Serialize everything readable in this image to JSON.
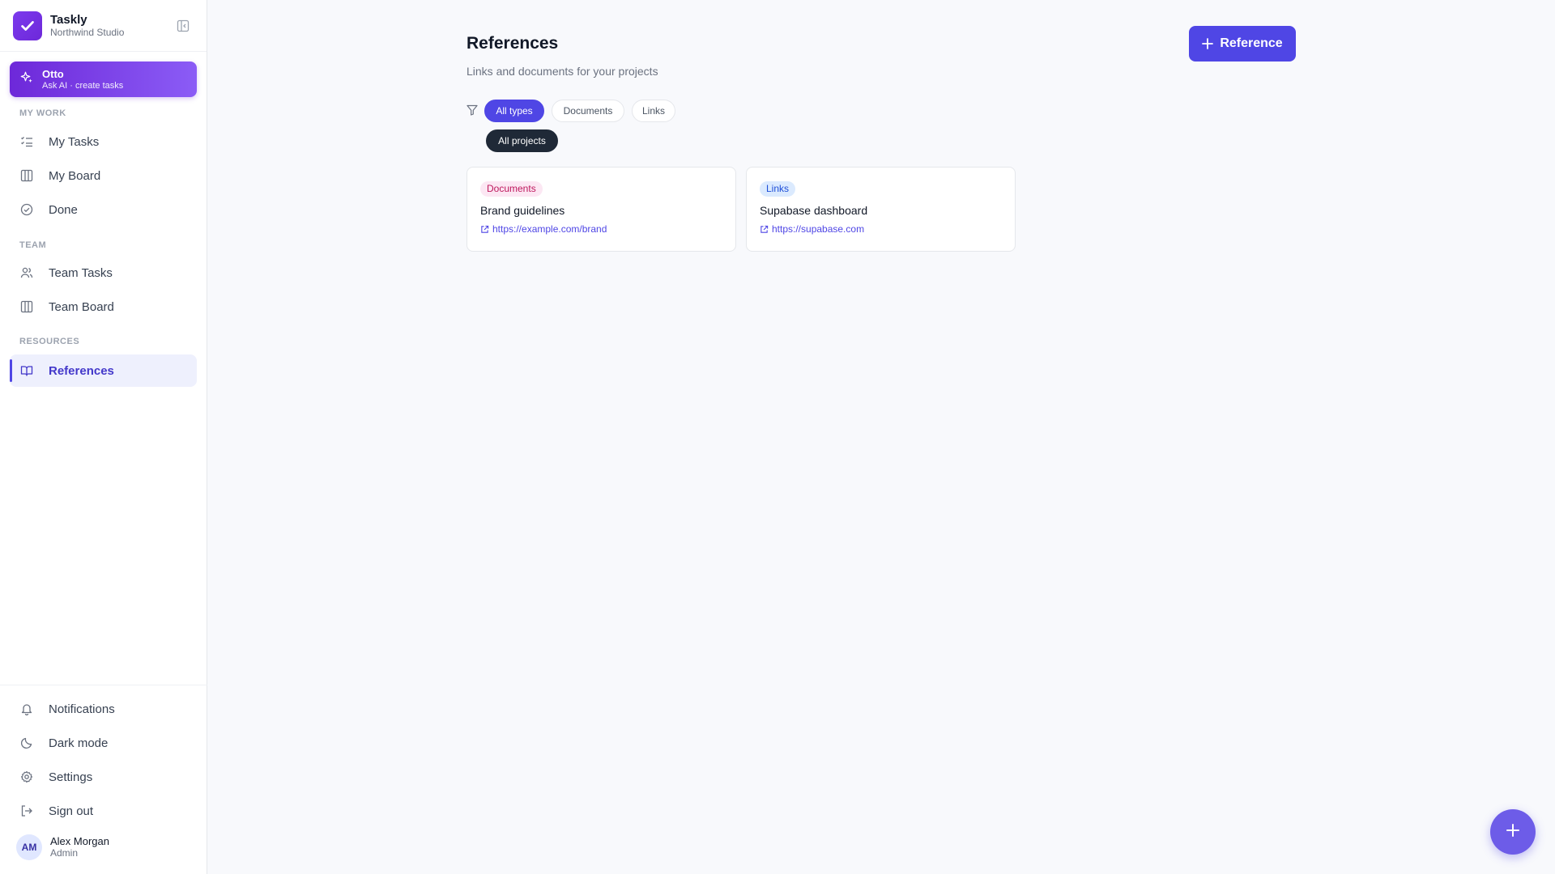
{
  "app": {
    "name": "Taskly",
    "org": "Northwind Studio"
  },
  "otto": {
    "title": "Otto",
    "subtitle": "Ask AI · create tasks"
  },
  "sections": {
    "my_work": "MY WORK",
    "team": "TEAM",
    "resources": "RESOURCES"
  },
  "nav": {
    "my_tasks": "My Tasks",
    "my_board": "My Board",
    "done": "Done",
    "team_tasks": "Team Tasks",
    "team_board": "Team Board",
    "references": "References"
  },
  "bottom_nav": {
    "notifications": "Notifications",
    "dark_mode": "Dark mode",
    "settings": "Settings",
    "sign_out": "Sign out"
  },
  "user": {
    "initials": "AM",
    "name": "Alex Morgan",
    "role": "Admin"
  },
  "page": {
    "title": "References",
    "subtitle": "Links and documents for your projects",
    "add_label": "Reference"
  },
  "filters": {
    "types": [
      "All types",
      "Documents",
      "Links"
    ],
    "projects": [
      "All projects"
    ]
  },
  "cards": [
    {
      "badge": "Documents",
      "title": "Brand guidelines",
      "url": "https://example.com/brand"
    },
    {
      "badge": "Links",
      "title": "Supabase dashboard",
      "url": "https://supabase.com"
    }
  ],
  "colors": {
    "accent": "#4f46e5",
    "brand": "#7c3aed",
    "background": "#f8f9fc"
  }
}
